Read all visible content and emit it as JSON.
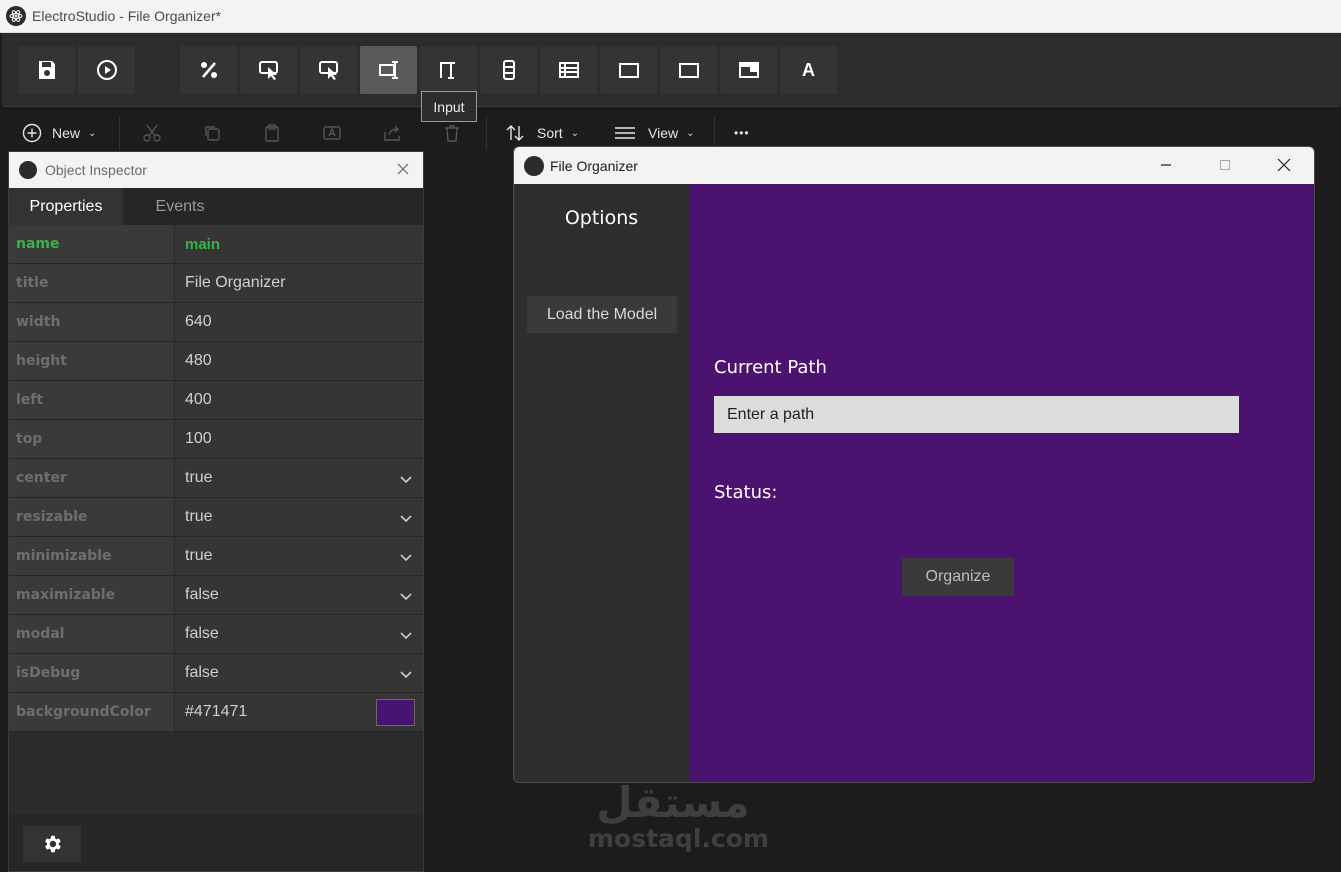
{
  "app": {
    "title": "ElectroStudio - File Organizer*"
  },
  "toolbar": {
    "buttons": [
      "save-icon",
      "play-icon",
      "percent-icon",
      "click-icon",
      "click-alt-icon",
      "input-icon",
      "label-icon",
      "column-icon",
      "list-icon",
      "rectangle-icon",
      "rectangle-alt-icon",
      "window-icon",
      "text-icon"
    ],
    "active": "input-icon",
    "text_button_glyph": "A",
    "tooltip": "Input"
  },
  "cmdbar": {
    "new_label": "New",
    "sort_label": "Sort",
    "view_label": "View",
    "more_label": "•••"
  },
  "inspector": {
    "title": "Object Inspector",
    "tabs": [
      "Properties",
      "Events"
    ],
    "active_tab": "Properties",
    "properties": [
      {
        "key": "name",
        "value": "main"
      },
      {
        "key": "title",
        "value": "File Organizer"
      },
      {
        "key": "width",
        "value": "640"
      },
      {
        "key": "height",
        "value": "480"
      },
      {
        "key": "left",
        "value": "400"
      },
      {
        "key": "top",
        "value": "100"
      },
      {
        "key": "center",
        "value": "true"
      },
      {
        "key": "resizable",
        "value": "true"
      },
      {
        "key": "minimizable",
        "value": "true"
      },
      {
        "key": "maximizable",
        "value": "false"
      },
      {
        "key": "modal",
        "value": "false"
      },
      {
        "key": "isDebug",
        "value": "false"
      },
      {
        "key": "backgroundColor",
        "value": "#471471"
      }
    ],
    "swatch_color": "#471471"
  },
  "preview": {
    "title": "File Organizer",
    "sidebar_title": "Options",
    "load_button": "Load the Model",
    "current_path_label": "Current Path",
    "path_placeholder": "Enter a path",
    "status_label": "Status:",
    "organize_button": "Organize",
    "background": "#4b136f"
  },
  "watermark": {
    "arabic": "مستقل",
    "latin": "mostaql.com"
  }
}
